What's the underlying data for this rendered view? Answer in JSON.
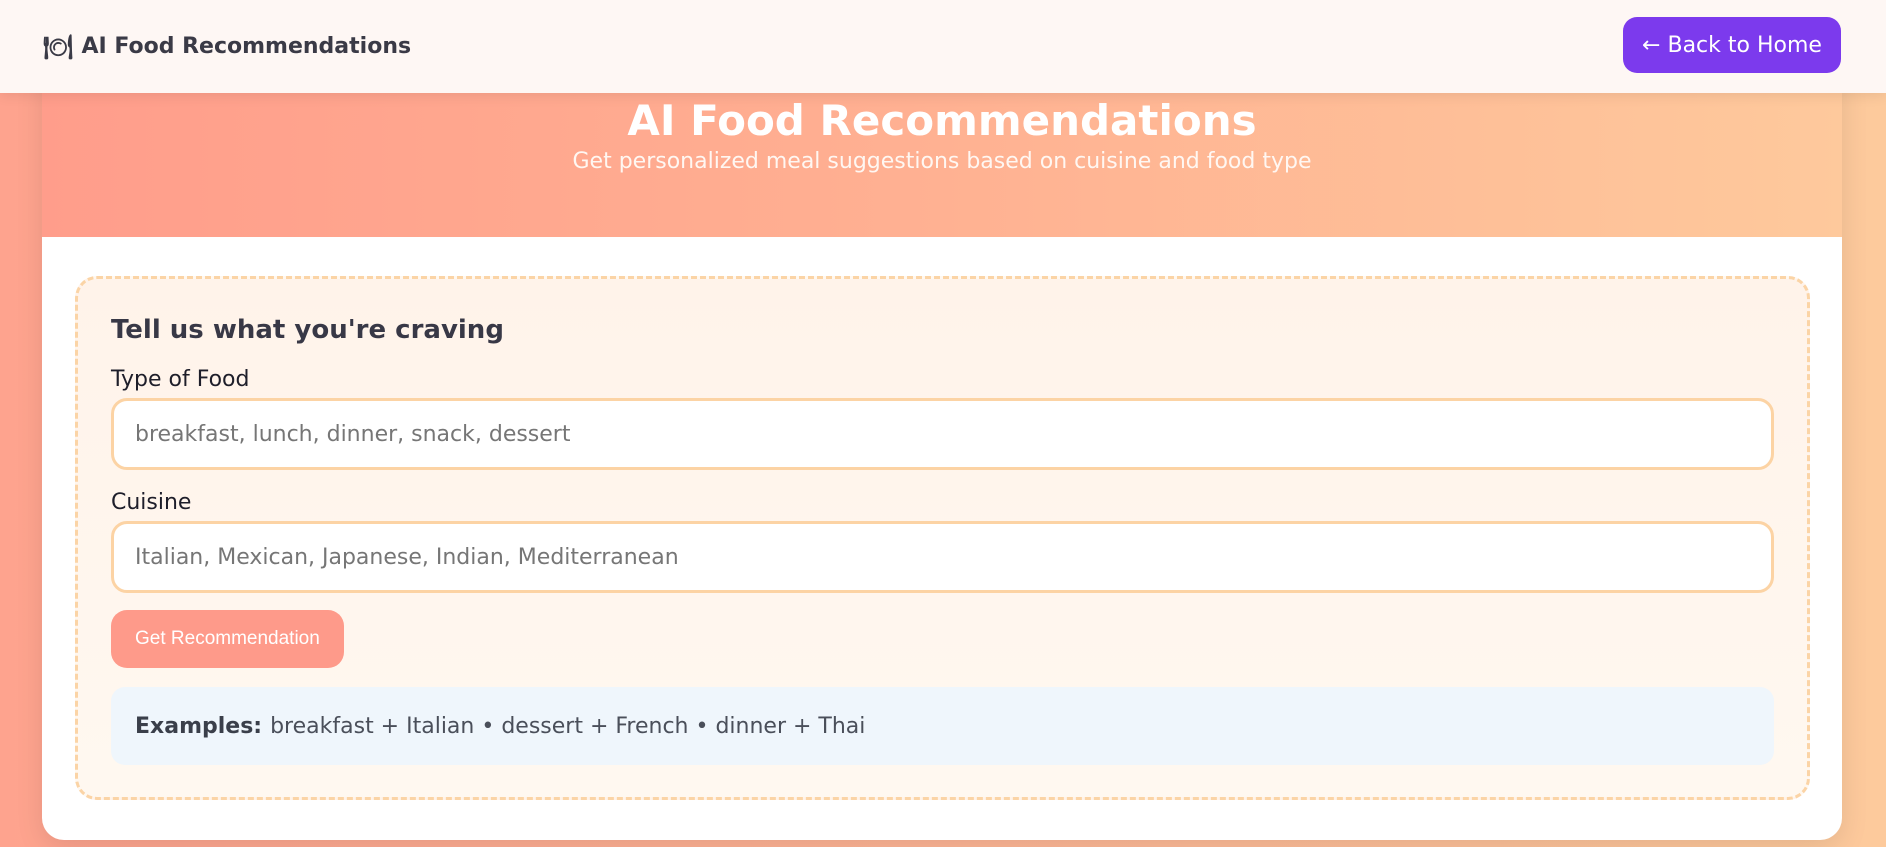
{
  "navbar": {
    "icon": "plate-cutlery-icon",
    "brand": "AI Food Recommendations",
    "back_label": "← Back to Home"
  },
  "hero": {
    "title": "AI Food Recommendations",
    "subtitle": "Get personalized meal suggestions based on cuisine and food type"
  },
  "form": {
    "heading": "Tell us what you're craving",
    "food_type_label": "Type of Food",
    "food_type_placeholder": "breakfast, lunch, dinner, snack, dessert",
    "food_type_value": "",
    "cuisine_label": "Cuisine",
    "cuisine_placeholder": "Italian, Mexican, Japanese, Indian, Mediterranean",
    "cuisine_value": "",
    "submit_label": "Get Recommendation"
  },
  "examples": {
    "label": "Examples:",
    "text": "breakfast + Italian • dessert + French • dinner + Thai"
  },
  "colors": {
    "accent_purple": "#7c3aed",
    "button_coral": "#fe9a8a",
    "input_border": "#fcd3a4"
  }
}
